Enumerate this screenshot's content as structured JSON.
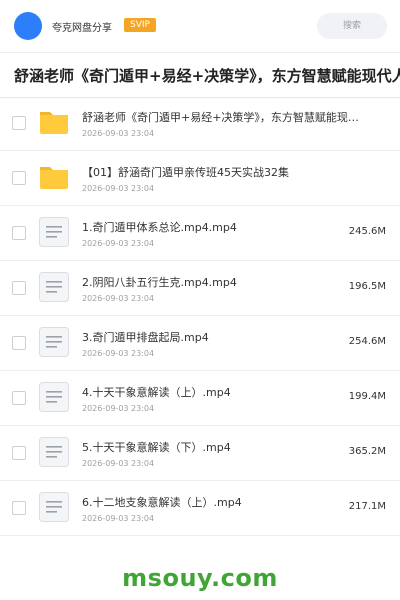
{
  "header": {
    "username": "夸克网盘分享",
    "badge": "SVIP",
    "search_placeholder": "搜索",
    "colors": {
      "avatar": "#2d7ff9",
      "badge": "#f5a524"
    }
  },
  "folder_title": "舒涵老师《奇门遁甲+易经+决策学》，东方智慧赋能现代人",
  "files": [
    {
      "name": "舒涵老师《奇门遁甲+易经+决策学》，东方智慧赋能现…",
      "date": "2026-09-03 23:04",
      "size": "",
      "icon": "folder-icon"
    },
    {
      "name": "【01】舒涵奇门遁甲亲传班45天实战32集",
      "date": "2026-09-03 23:04",
      "size": "",
      "icon": "folder-icon"
    },
    {
      "name": "1.奇门遁甲体系总论.mp4.mp4",
      "date": "2026-09-03 23:04",
      "size": "245.6M",
      "icon": "file-icon"
    },
    {
      "name": "2.阴阳八卦五行生克.mp4.mp4",
      "date": "2026-09-03 23:04",
      "size": "196.5M",
      "icon": "file-icon"
    },
    {
      "name": "3.奇门遁甲排盘起局.mp4",
      "date": "2026-09-03 23:04",
      "size": "254.6M",
      "icon": "file-icon"
    },
    {
      "name": "4.十天干象意解读（上）.mp4",
      "date": "2026-09-03 23:04",
      "size": "199.4M",
      "icon": "file-icon"
    },
    {
      "name": "5.十天干象意解读（下）.mp4",
      "date": "2026-09-03 23:04",
      "size": "365.2M",
      "icon": "file-icon"
    },
    {
      "name": "6.十二地支象意解读（上）.mp4",
      "date": "2026-09-03 23:04",
      "size": "217.1M",
      "icon": "file-icon"
    }
  ],
  "watermark": "msouy.com"
}
